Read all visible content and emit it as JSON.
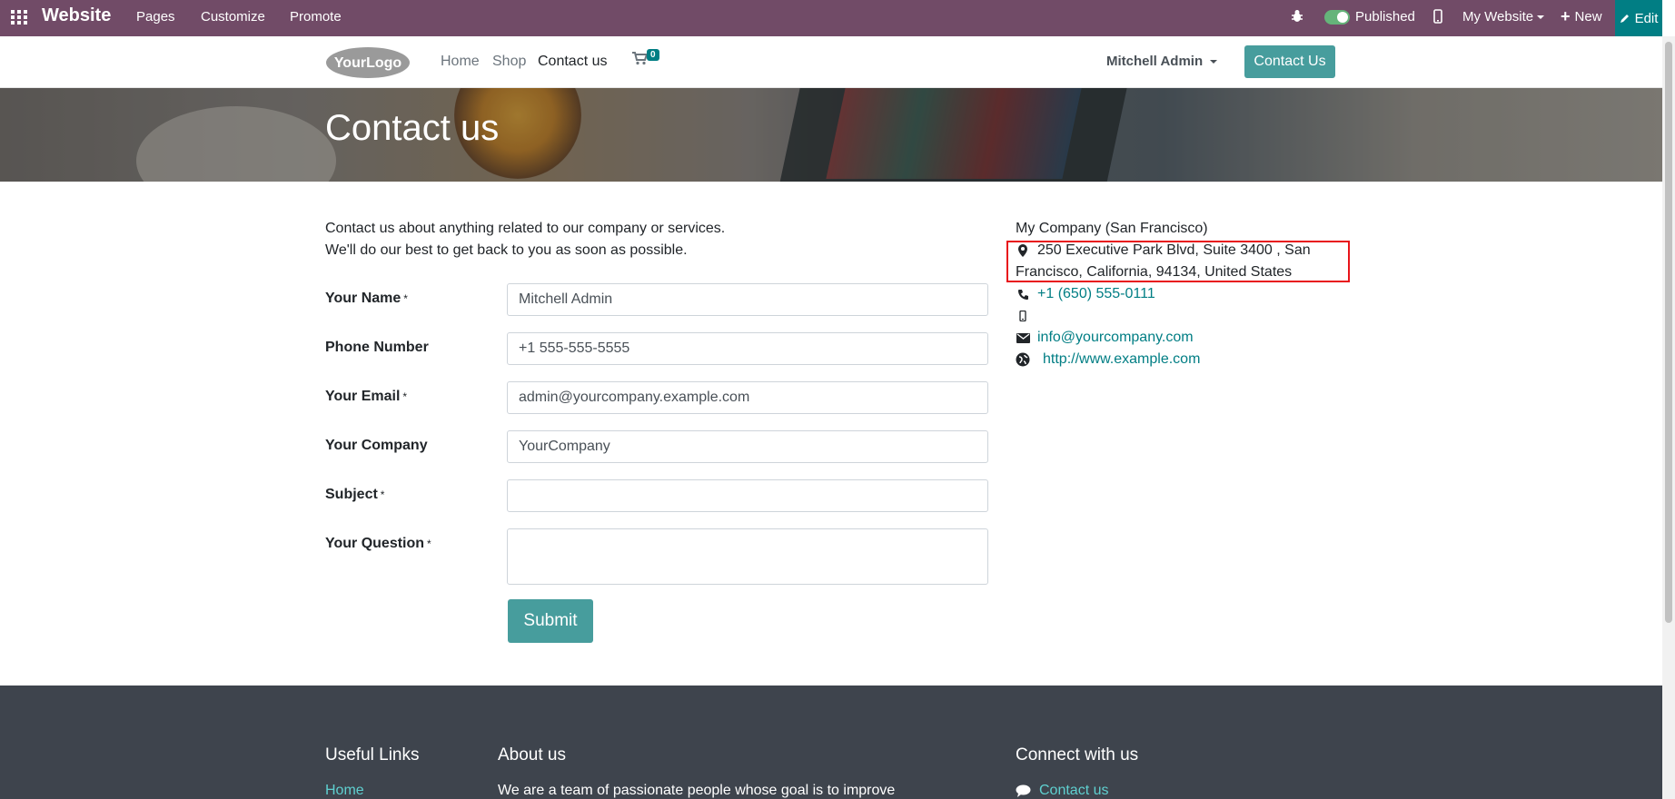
{
  "adminbar": {
    "app_name": "Website",
    "menu": [
      "Pages",
      "Customize",
      "Promote"
    ],
    "published_label": "Published",
    "website_label": "My Website",
    "new_label": "New",
    "edit_label": "Edit",
    "color": "#714b67",
    "edit_color": "#017e84"
  },
  "header": {
    "logo_text": "YourLogo",
    "nav": [
      "Home",
      "Shop",
      "Contact us"
    ],
    "cart_count": "0",
    "user_name": "Mitchell Admin",
    "contact_button": "Contact Us"
  },
  "hero": {
    "title": "Contact us"
  },
  "intro": {
    "line1": "Contact us about anything related to our company or services.",
    "line2": "We'll do our best to get back to you as soon as possible."
  },
  "form": {
    "fields": [
      {
        "label": "Your Name",
        "required": "*",
        "value": "Mitchell Admin"
      },
      {
        "label": "Phone Number",
        "required": "",
        "value": "+1 555-555-5555"
      },
      {
        "label": "Your Email",
        "required": "*",
        "value": "admin@yourcompany.example.com"
      },
      {
        "label": "Your Company",
        "required": "",
        "value": "YourCompany"
      },
      {
        "label": "Subject",
        "required": "*",
        "value": ""
      },
      {
        "label": "Your Question",
        "required": "*",
        "value": ""
      }
    ],
    "submit_label": "Submit"
  },
  "company": {
    "name": "My Company (San Francisco)",
    "address_line1": "250 Executive Park Blvd, Suite 3400 , San",
    "address_line2": "Francisco, California, 94134, United States",
    "phone": "+1 (650) 555-0111",
    "email": "info@yourcompany.com",
    "website": "http://www.example.com"
  },
  "footer": {
    "useful_links_title": "Useful Links",
    "home_link": "Home",
    "about_title": "About us",
    "about_text": "We are a team of passionate people whose goal is to improve",
    "connect_title": "Connect with us",
    "contact_link": "Contact us"
  }
}
